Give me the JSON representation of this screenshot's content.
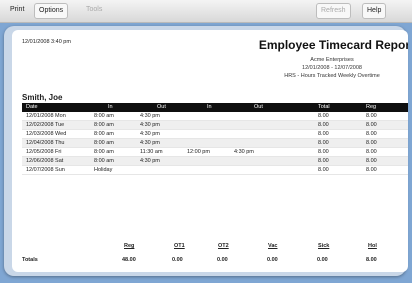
{
  "toolbar": {
    "items": [
      "Print",
      "Options",
      "Tools",
      "",
      "",
      "Refresh",
      "Help"
    ]
  },
  "report": {
    "timestamp": "12/01/2008 3:40 pm",
    "title": "Employee Timecard Report",
    "company": "Acme Enterprises",
    "date_range": "12/01/2008 - 12/07/2008",
    "filter": "HRS - Hours Tracked Weekly Overtime",
    "employee": "Smith, Joe",
    "columns": [
      "Date",
      "In",
      "Out",
      "In",
      "Out",
      "Total",
      "Reg"
    ],
    "rows": [
      [
        "12/01/2008 Mon",
        "8:00 am",
        "4:30 pm",
        "",
        "",
        "8.00",
        "8.00"
      ],
      [
        "12/02/2008 Tue",
        "8:00 am",
        "4:30 pm",
        "",
        "",
        "8.00",
        "8.00"
      ],
      [
        "12/03/2008 Wed",
        "8:00 am",
        "4:30 pm",
        "",
        "",
        "8.00",
        "8.00"
      ],
      [
        "12/04/2008 Thu",
        "8:00 am",
        "4:30 pm",
        "",
        "",
        "8.00",
        "8.00"
      ],
      [
        "12/05/2008 Fri",
        "8:00 am",
        "11:30 am",
        "12:00 pm",
        "4:30 pm",
        "8.00",
        "8.00"
      ],
      [
        "12/06/2008 Sat",
        "8:00 am",
        "4:30 pm",
        "",
        "",
        "8.00",
        "8.00"
      ],
      [
        "12/07/2008 Sun",
        "Holiday",
        "",
        "",
        "",
        "8.00",
        "8.00"
      ]
    ],
    "totals_label": "Totals",
    "summary_headers": [
      "Reg",
      "OT1",
      "OT2",
      "Vac",
      "Sick",
      "Hol"
    ],
    "summary_values": [
      "48.00",
      "0.00",
      "0.00",
      "0.00",
      "0.00",
      "8.00"
    ]
  }
}
